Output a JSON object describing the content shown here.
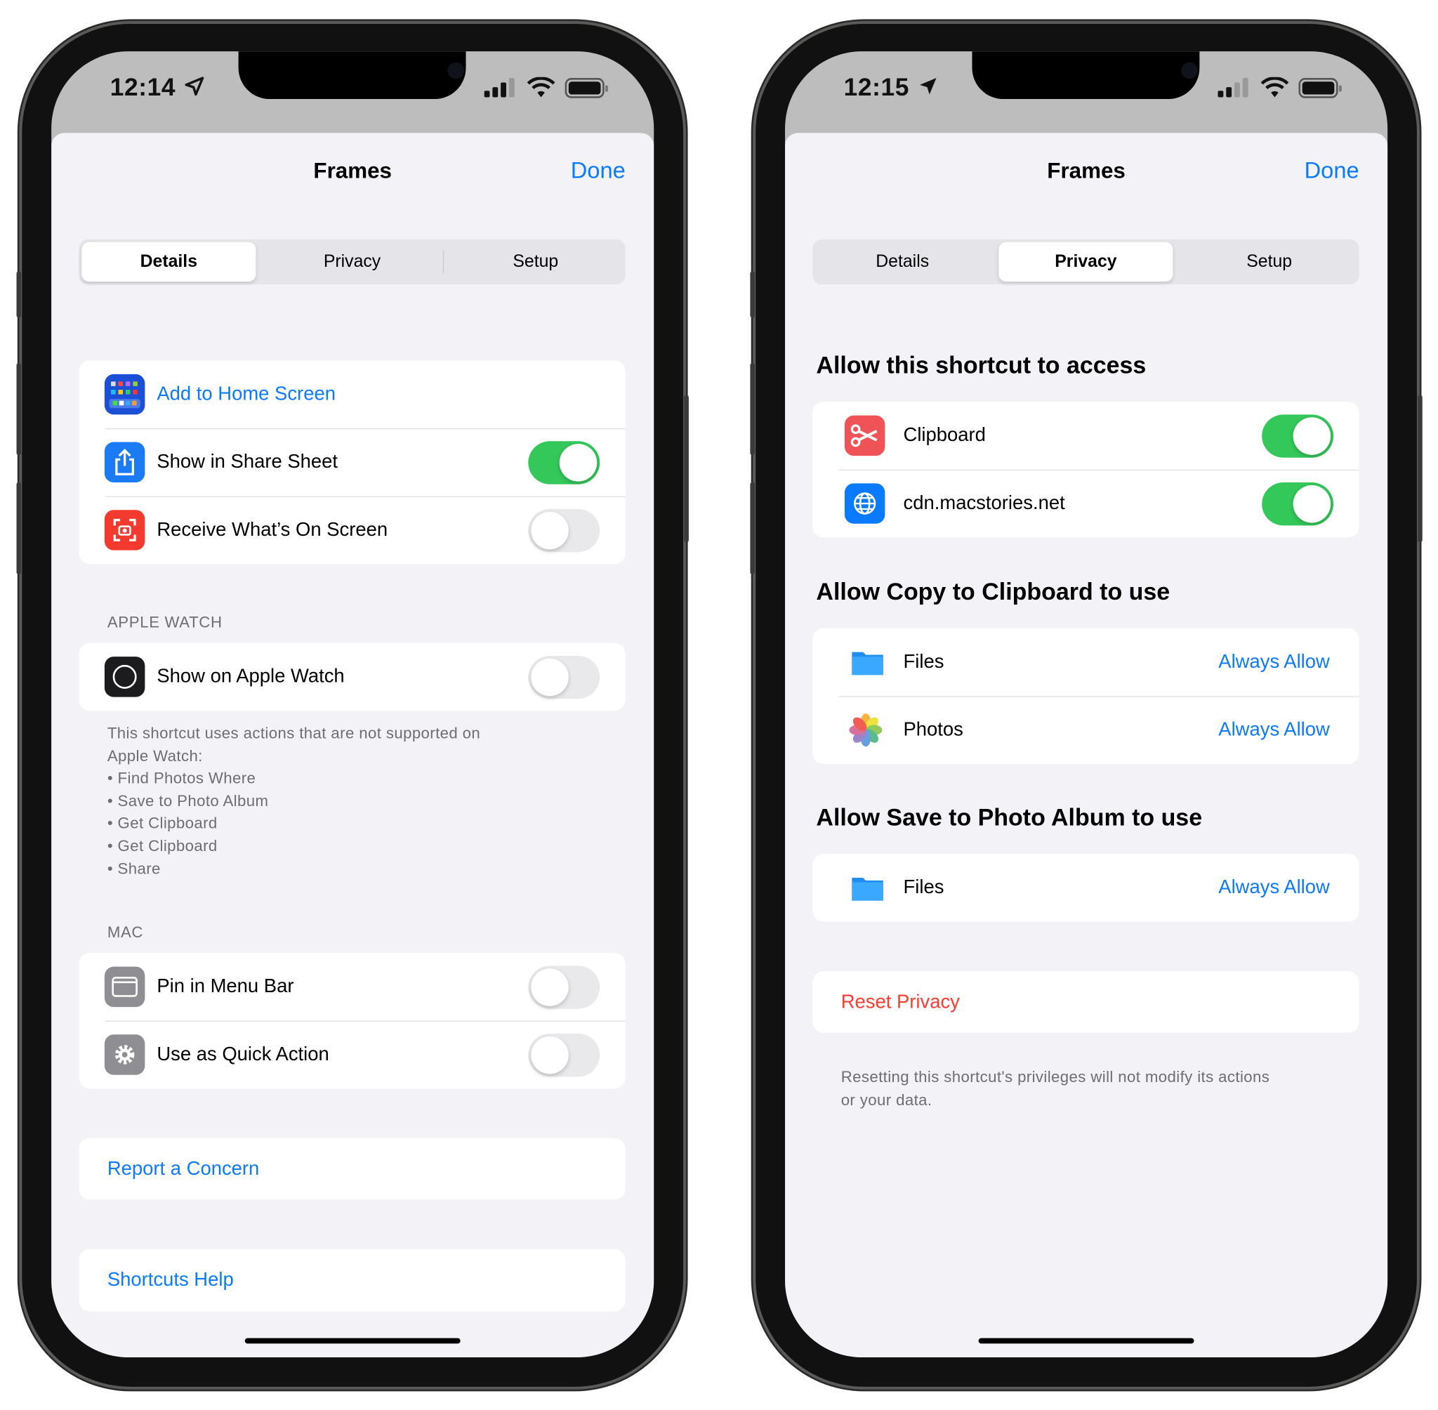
{
  "colors": {
    "accent": "#0a7aff",
    "toggle_on": "#34c759",
    "destructive": "#ff3b30"
  },
  "left": {
    "status": {
      "time": "12:14",
      "location_icon": "location-arrow-outline-icon"
    },
    "nav": {
      "title": "Frames",
      "done": "Done"
    },
    "segments": [
      {
        "label": "Details",
        "selected": true
      },
      {
        "label": "Privacy",
        "selected": false
      },
      {
        "label": "Setup",
        "selected": false
      }
    ],
    "general": [
      {
        "label": "Add to Home Screen",
        "icon": "home-screen-grid-icon",
        "link": true
      },
      {
        "label": "Show in Share Sheet",
        "icon": "share-icon",
        "toggle": true
      },
      {
        "label": "Receive What’s On Screen",
        "icon": "screen-capture-icon",
        "toggle": false
      }
    ],
    "watch": {
      "header": "APPLE WATCH",
      "label": "Show on Apple Watch",
      "toggle": false,
      "footer": [
        "This shortcut uses actions that are not supported on",
        "Apple Watch:",
        "• Find Photos Where",
        "• Save to Photo Album",
        "• Get Clipboard",
        "• Get Clipboard",
        "• Share"
      ]
    },
    "mac": {
      "header": "MAC",
      "items": [
        {
          "label": "Pin in Menu Bar",
          "toggle": false
        },
        {
          "label": "Use as Quick Action",
          "toggle": false
        }
      ]
    },
    "report": "Report a Concern",
    "help": "Shortcuts Help"
  },
  "right": {
    "status": {
      "time": "12:15",
      "location_icon": "location-arrow-filled-icon"
    },
    "nav": {
      "title": "Frames",
      "done": "Done"
    },
    "segments": [
      {
        "label": "Details",
        "selected": false
      },
      {
        "label": "Privacy",
        "selected": true
      },
      {
        "label": "Setup",
        "selected": false
      }
    ],
    "access": {
      "heading": "Allow this shortcut to access",
      "items": [
        {
          "label": "Clipboard",
          "toggle": true
        },
        {
          "label": "cdn.macstories.net",
          "toggle": true
        }
      ]
    },
    "copy": {
      "heading": "Allow Copy to Clipboard to use",
      "items": [
        {
          "label": "Files",
          "value": "Always Allow"
        },
        {
          "label": "Photos",
          "value": "Always Allow"
        }
      ]
    },
    "save": {
      "heading": "Allow Save to Photo Album to use",
      "items": [
        {
          "label": "Files",
          "value": "Always Allow"
        }
      ]
    },
    "reset": "Reset Privacy",
    "reset_footer": [
      "Resetting this shortcut's privileges will not modify its actions",
      "or your data."
    ]
  }
}
